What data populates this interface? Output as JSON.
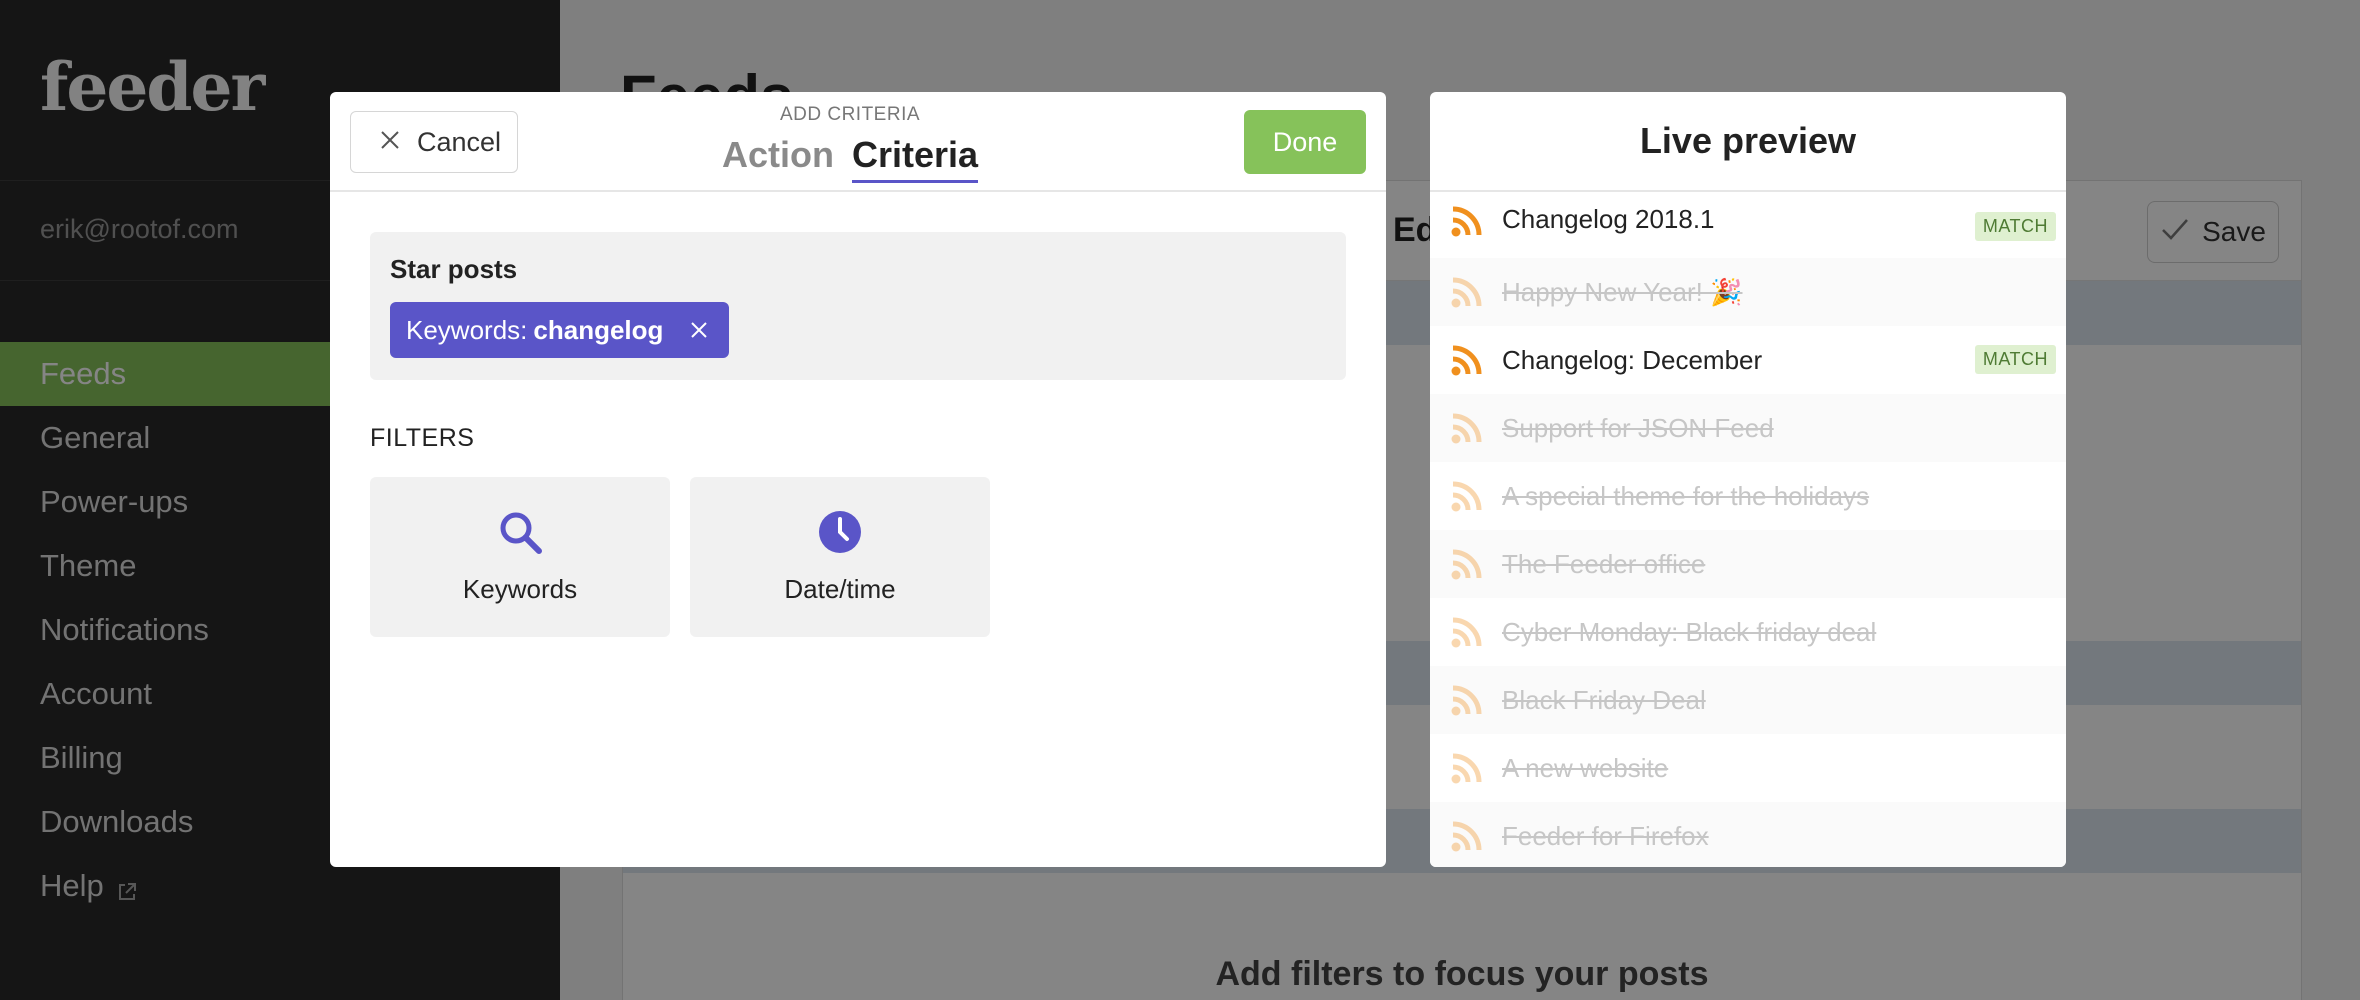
{
  "brand": {
    "logo_text": "feeder"
  },
  "sidebar": {
    "user_email": "erik@rootof.com",
    "items": [
      {
        "label": "Feeds",
        "active": true
      },
      {
        "label": "General"
      },
      {
        "label": "Power-ups"
      },
      {
        "label": "Theme"
      },
      {
        "label": "Notifications"
      },
      {
        "label": "Account"
      },
      {
        "label": "Billing"
      },
      {
        "label": "Downloads"
      },
      {
        "label": "Help",
        "external": true
      }
    ]
  },
  "background": {
    "page_title": "Feeds",
    "card_heading": "Ed",
    "save_label": "Save",
    "cta_text": "Add filters to focus your posts"
  },
  "modal": {
    "cancel_label": "Cancel",
    "kicker": "ADD CRITERIA",
    "tabs": [
      {
        "label": "Action",
        "active": false
      },
      {
        "label": "Criteria",
        "active": true
      }
    ],
    "done_label": "Done",
    "action_title": "Star posts",
    "criteria_chip": {
      "prefix": "Keywords:",
      "value": "changelog"
    },
    "filters_label": "FILTERS",
    "filters": [
      {
        "label": "Keywords",
        "icon": "search-icon"
      },
      {
        "label": "Date/time",
        "icon": "clock-icon"
      }
    ]
  },
  "preview": {
    "title": "Live preview",
    "match_label": "MATCH",
    "items": [
      {
        "title": "Changelog 2018.1",
        "match": true
      },
      {
        "title": "Happy New Year! 🎉",
        "match": false
      },
      {
        "title": "Changelog: December",
        "match": true
      },
      {
        "title": "Support for JSON Feed",
        "match": false
      },
      {
        "title": "A special theme for the holidays",
        "match": false
      },
      {
        "title": "The Feeder office",
        "match": false
      },
      {
        "title": "Cyber Monday: Black friday deal",
        "match": false
      },
      {
        "title": "Black Friday Deal",
        "match": false
      },
      {
        "title": "A new website",
        "match": false
      },
      {
        "title": "Feeder for Firefox",
        "match": false
      }
    ]
  },
  "colors": {
    "accent": "#5a55c8",
    "success": "#86c25a",
    "rss": "#f0901e",
    "sidebar_bg": "#2a2a2a"
  }
}
